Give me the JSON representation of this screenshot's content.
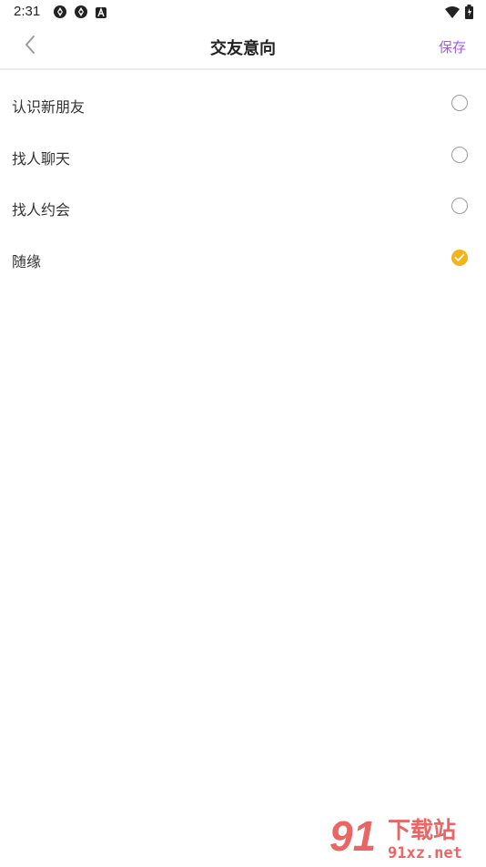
{
  "status_bar": {
    "time": "2:31"
  },
  "header": {
    "title": "交友意向",
    "save_label": "保存"
  },
  "options": [
    {
      "label": "认识新朋友",
      "selected": false
    },
    {
      "label": "找人聊天",
      "selected": false
    },
    {
      "label": "找人约会",
      "selected": false
    },
    {
      "label": "随缘",
      "selected": true
    }
  ],
  "watermark": {
    "logo_text": "91",
    "site_name": "下载站",
    "domain": "91xz.net"
  },
  "colors": {
    "accent": "#a25cf0",
    "check": "#f6b21b"
  }
}
